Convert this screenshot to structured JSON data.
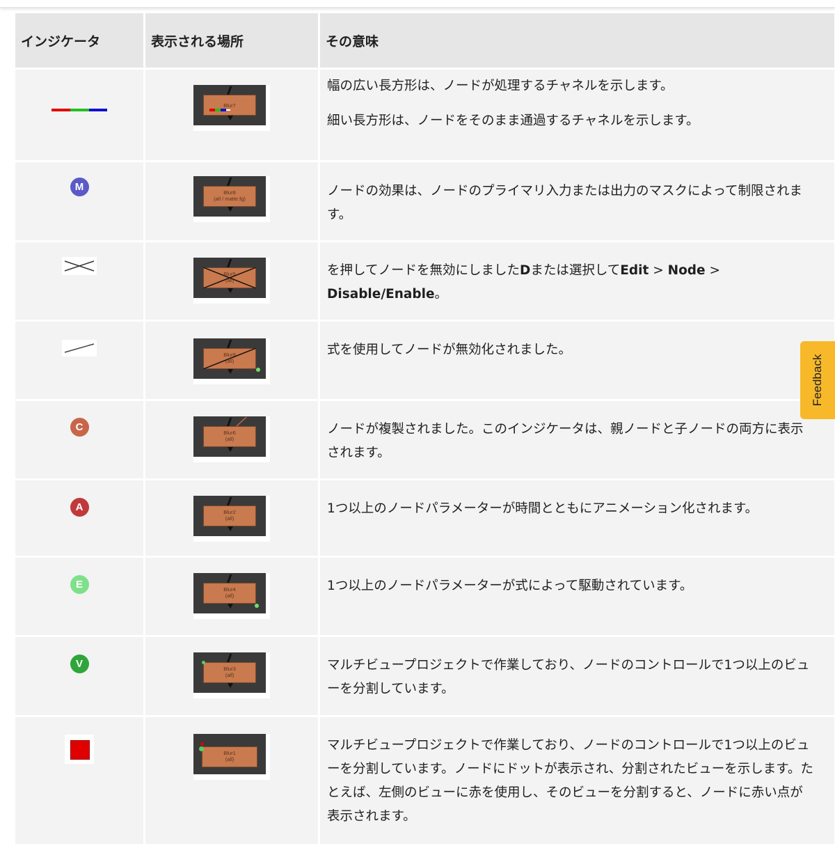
{
  "table": {
    "headers": {
      "indicator": "インジケータ",
      "location": "表示される場所",
      "meaning": "その意味"
    },
    "rows": [
      {
        "icon": "rgb-channel-bar-icon",
        "node_label": "Blur7",
        "node_sub": "",
        "lines": [
          "幅の広い長方形は、ノードが処理するチャネルを示します。",
          "細い長方形は、ノードをそのまま通過するチャネルを示します。"
        ]
      },
      {
        "icon": "mask-m-icon",
        "icon_letter": "M",
        "icon_color": "#5a5ac8",
        "node_label": "Blur8",
        "node_sub": "(all / matte.fg)",
        "lines": [
          "ノードの効果は、ノードのプライマリ入力または出力のマスクによって制限されます。"
        ]
      },
      {
        "icon": "disabled-x-icon",
        "node_label": "Blur5",
        "node_sub": "(all)",
        "text_a": "を押してノードを無効にしました",
        "key_d": "D",
        "text_b": "または選択して",
        "menu_edit": "Edit",
        "sep1": " > ",
        "menu_node": "Node",
        "sep2": " > ",
        "menu_disable": "Disable/Enable",
        "text_c": "。"
      },
      {
        "icon": "expression-disabled-line-icon",
        "node_label": "Blur9",
        "node_sub": "(all)",
        "lines": [
          "式を使用してノードが無効化されました。"
        ]
      },
      {
        "icon": "clone-c-icon",
        "icon_letter": "C",
        "icon_color": "#c8664a",
        "node_label": "Blur6",
        "node_sub": "(all)",
        "lines": [
          "ノードが複製されました。このインジケータは、親ノードと子ノードの両方に表示されます。"
        ]
      },
      {
        "icon": "animated-a-icon",
        "icon_letter": "A",
        "icon_color": "#c0393b",
        "node_label": "Blur2",
        "node_sub": "(all)",
        "lines": [
          "1つ以上のノードパラメーターが時間とともにアニメーション化されます。"
        ]
      },
      {
        "icon": "expression-e-icon",
        "icon_letter": "E",
        "icon_color": "#7fe08a",
        "node_label": "Blur4",
        "node_sub": "(all)",
        "lines": [
          "1つ以上のノードパラメーターが式によって駆動されています。"
        ]
      },
      {
        "icon": "multiview-v-icon",
        "icon_letter": "V",
        "icon_color": "#2fa63a",
        "node_label": "Blur3",
        "node_sub": "(all)",
        "lines": [
          "マルチビュープロジェクトで作業しており、ノードのコントロールで1つ以上のビューを分割しています。"
        ]
      },
      {
        "icon": "view-dot-red-square-icon",
        "icon_color": "#e00000",
        "node_label": "Blur1",
        "node_sub": "(all)",
        "lines": [
          "マルチビュープロジェクトで作業しており、ノードのコントロールで1つ以上のビューを分割しています。ノードにドットが表示され、分割されたビューを示します。たとえば、左側のビューに赤を使用し、そのビューを分割すると、ノードに赤い点が表示されます。"
        ]
      }
    ]
  },
  "feedback_label": "Feedback"
}
